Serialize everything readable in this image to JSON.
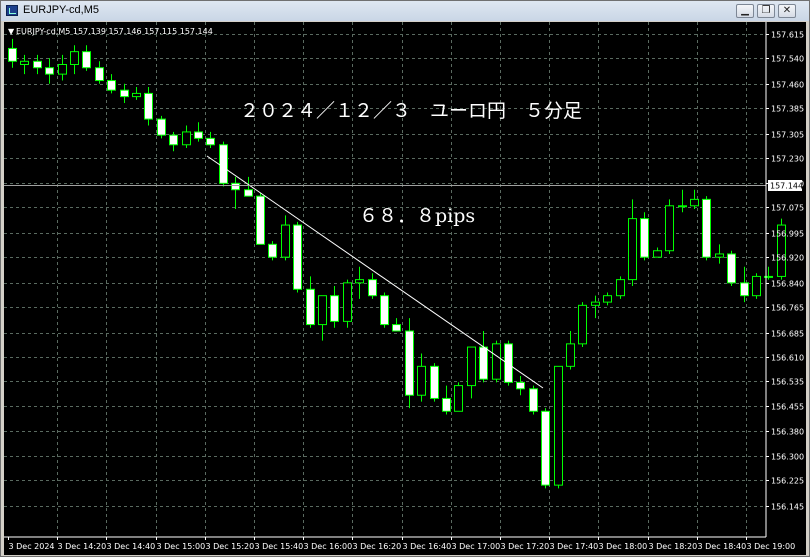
{
  "window": {
    "title": "EURJPY-cd,M5",
    "min_icon": "minimize-icon",
    "restore_icon": "restore-icon",
    "close_icon": "close-icon"
  },
  "chart_info": "EURJPY-cd,M5  157.139 157.146 157.115 157.144",
  "annotation_title": "２０２４／１２／３　ユーロ円　５分足",
  "annotation_pips": "６８．８pips",
  "current_price_label": "157.144",
  "colors": {
    "background": "#000000",
    "grid": "#5a6a60",
    "bull_fill": "#000000",
    "bull_border": "#00ff00",
    "bear_fill": "#ffffff",
    "bear_border": "#00ff00",
    "axis_text": "#ffffff",
    "trendline": "#ffffff",
    "current_price_line": "#a0a0a0"
  },
  "chart_data": {
    "type": "candlestick",
    "symbol": "EURJPY-cd",
    "timeframe": "M5",
    "ylim": [
      156.145,
      157.615
    ],
    "yticks": [
      "157.615",
      "157.540",
      "157.460",
      "157.385",
      "157.305",
      "157.230",
      "157.150",
      "157.075",
      "156.995",
      "156.920",
      "156.840",
      "156.765",
      "156.685",
      "156.610",
      "156.535",
      "156.455",
      "156.380",
      "156.300",
      "156.225",
      "156.145"
    ],
    "xticks": [
      "3 Dec 2024",
      "3 Dec 14:20",
      "3 Dec 14:40",
      "3 Dec 15:00",
      "3 Dec 15:20",
      "3 Dec 15:40",
      "3 Dec 16:00",
      "3 Dec 16:20",
      "3 Dec 16:40",
      "3 Dec 17:00",
      "3 Dec 17:20",
      "3 Dec 17:40",
      "3 Dec 18:00",
      "3 Dec 18:20",
      "3 Dec 18:40",
      "3 Dec 19:00"
    ],
    "grid": true,
    "candles": [
      [
        157.57,
        157.6,
        157.51,
        157.53
      ],
      [
        157.52,
        157.55,
        157.49,
        157.53
      ],
      [
        157.53,
        157.55,
        157.49,
        157.51
      ],
      [
        157.51,
        157.54,
        157.46,
        157.49
      ],
      [
        157.49,
        157.55,
        157.47,
        157.52
      ],
      [
        157.52,
        157.58,
        157.49,
        157.56
      ],
      [
        157.56,
        157.58,
        157.5,
        157.51
      ],
      [
        157.51,
        157.53,
        157.46,
        157.47
      ],
      [
        157.47,
        157.49,
        157.43,
        157.44
      ],
      [
        157.44,
        157.46,
        157.4,
        157.42
      ],
      [
        157.42,
        157.45,
        157.41,
        157.43
      ],
      [
        157.43,
        157.45,
        157.33,
        157.35
      ],
      [
        157.35,
        157.36,
        157.29,
        157.3
      ],
      [
        157.3,
        157.31,
        157.25,
        157.27
      ],
      [
        157.27,
        157.33,
        157.26,
        157.31
      ],
      [
        157.31,
        157.34,
        157.28,
        157.29
      ],
      [
        157.29,
        157.31,
        157.26,
        157.27
      ],
      [
        157.27,
        157.28,
        157.14,
        157.15
      ],
      [
        157.15,
        157.17,
        157.07,
        157.13
      ],
      [
        157.13,
        157.17,
        157.11,
        157.11
      ],
      [
        157.11,
        157.12,
        156.96,
        156.96
      ],
      [
        156.96,
        156.97,
        156.91,
        156.92
      ],
      [
        156.92,
        157.05,
        156.91,
        157.02
      ],
      [
        157.02,
        157.03,
        156.81,
        156.82
      ],
      [
        156.82,
        156.86,
        156.7,
        156.71
      ],
      [
        156.71,
        156.8,
        156.66,
        156.8
      ],
      [
        156.8,
        156.83,
        156.7,
        156.72
      ],
      [
        156.72,
        156.85,
        156.7,
        156.84
      ],
      [
        156.84,
        156.89,
        156.79,
        156.85
      ],
      [
        156.85,
        156.87,
        156.79,
        156.8
      ],
      [
        156.8,
        156.81,
        156.7,
        156.71
      ],
      [
        156.71,
        156.73,
        156.69,
        156.69
      ],
      [
        156.69,
        156.73,
        156.45,
        156.49
      ],
      [
        156.49,
        156.62,
        156.47,
        156.58
      ],
      [
        156.58,
        156.59,
        156.47,
        156.48
      ],
      [
        156.48,
        156.52,
        156.43,
        156.44
      ],
      [
        156.44,
        156.53,
        156.44,
        156.52
      ],
      [
        156.52,
        156.64,
        156.48,
        156.64
      ],
      [
        156.64,
        156.69,
        156.53,
        156.54
      ],
      [
        156.54,
        156.66,
        156.53,
        156.65
      ],
      [
        156.65,
        156.66,
        156.52,
        156.53
      ],
      [
        156.53,
        156.55,
        156.49,
        156.51
      ],
      [
        156.51,
        156.52,
        156.43,
        156.44
      ],
      [
        156.44,
        156.45,
        156.2,
        156.21
      ],
      [
        156.21,
        156.58,
        156.2,
        156.58
      ],
      [
        156.58,
        156.69,
        156.57,
        156.65
      ],
      [
        156.65,
        156.78,
        156.64,
        156.77
      ],
      [
        156.77,
        156.8,
        156.73,
        156.78
      ],
      [
        156.78,
        156.81,
        156.77,
        156.8
      ],
      [
        156.8,
        156.86,
        156.79,
        156.85
      ],
      [
        156.85,
        157.1,
        156.83,
        157.04
      ],
      [
        157.04,
        157.06,
        156.91,
        156.92
      ],
      [
        156.92,
        156.95,
        156.92,
        156.94
      ],
      [
        156.94,
        157.1,
        156.93,
        157.08
      ],
      [
        157.08,
        157.13,
        157.06,
        157.08
      ],
      [
        157.08,
        157.13,
        157.07,
        157.1
      ],
      [
        157.1,
        157.11,
        156.91,
        156.92
      ],
      [
        156.92,
        156.96,
        156.9,
        156.93
      ],
      [
        156.93,
        156.94,
        156.83,
        156.84
      ],
      [
        156.84,
        156.89,
        156.78,
        156.8
      ],
      [
        156.8,
        156.87,
        156.79,
        156.86
      ],
      [
        156.86,
        156.89,
        156.85,
        156.86
      ],
      [
        156.86,
        157.04,
        156.85,
        157.02
      ]
    ]
  }
}
